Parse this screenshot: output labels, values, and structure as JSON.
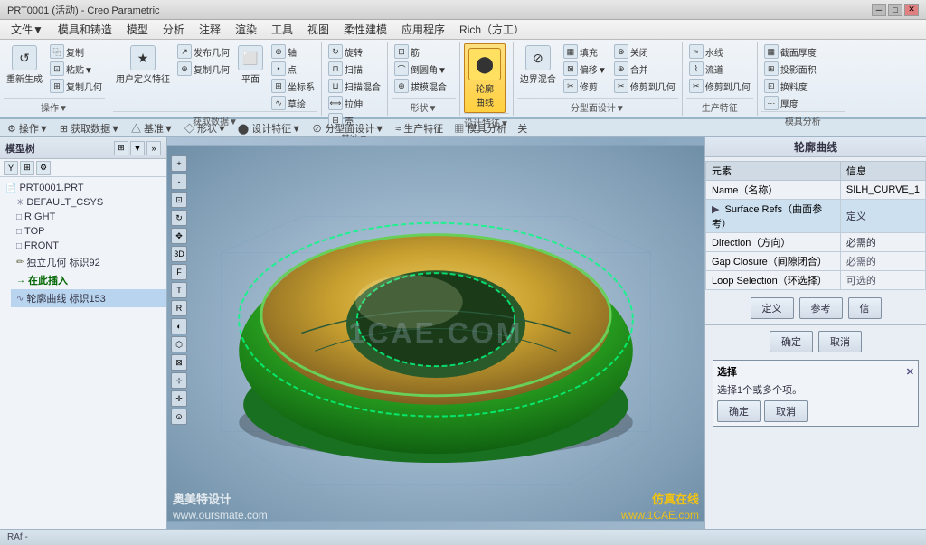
{
  "titlebar": {
    "title": "PRT0001 (活动) - Creo Parametric"
  },
  "menubar": {
    "items": [
      "文件▼",
      "模具和铸造",
      "模型",
      "分析",
      "注释",
      "渲染",
      "工具",
      "视图",
      "柔性建模",
      "应用程序",
      "Rich（方工）"
    ]
  },
  "ribbon": {
    "sections": [
      {
        "label": "操作▼",
        "buttons": [
          {
            "icon": "↺",
            "label": "重新生成"
          },
          {
            "icon": "⿻",
            "label": "复制"
          },
          {
            "icon": "⊡",
            "label": "粘贴▼"
          },
          {
            "icon": "⊞",
            "label": "复制几何"
          }
        ]
      },
      {
        "label": "获取数据▼",
        "buttons": [
          {
            "icon": "★",
            "label": "用户定义特征"
          },
          {
            "icon": "↗",
            "label": "发布几何"
          },
          {
            "icon": "•",
            "label": "复制几何"
          },
          {
            "icon": "⊕",
            "label": "轴"
          },
          {
            "icon": "•",
            "label": "点"
          },
          {
            "icon": "⊞",
            "label": "坐标系"
          },
          {
            "icon": "∿",
            "label": "草绘"
          },
          {
            "icon": "⬜",
            "label": "平面"
          }
        ]
      },
      {
        "label": "基准▼",
        "buttons": [
          {
            "icon": "↻",
            "label": "旋转"
          },
          {
            "icon": "⊓",
            "label": "扫描"
          },
          {
            "icon": "⊔",
            "label": "扫描混合"
          },
          {
            "icon": "⟺",
            "label": "拉伸"
          },
          {
            "icon": "⊟",
            "label": "壳"
          }
        ]
      },
      {
        "label": "形状▼",
        "buttons": [
          {
            "icon": "⊡",
            "label": "筋"
          },
          {
            "icon": "⌒",
            "label": "倒圆角▼"
          },
          {
            "icon": "⊕",
            "label": "拔模混合"
          }
        ]
      },
      {
        "label": "设计特征▼",
        "buttons": [
          {
            "icon": "⬤",
            "label": "轮廓\n曲线",
            "active": true
          }
        ]
      },
      {
        "label": "分型面设计▼",
        "buttons": [
          {
            "icon": "⊘",
            "label": "边界混合"
          },
          {
            "icon": "▦",
            "label": "填充"
          },
          {
            "icon": "⊠",
            "label": "偏移▼"
          },
          {
            "icon": "✂",
            "label": "修剪"
          },
          {
            "icon": "⊗",
            "label": "关闭"
          },
          {
            "icon": "⊕",
            "label": "合并"
          },
          {
            "icon": "✂",
            "label": "修剪到几何"
          }
        ]
      },
      {
        "label": "生产特征",
        "buttons": [
          {
            "icon": "≈",
            "label": "水线"
          },
          {
            "icon": "⌇",
            "label": "流道"
          },
          {
            "icon": "✂",
            "label": "修剪到几何"
          }
        ]
      },
      {
        "label": "模具分析",
        "buttons": [
          {
            "icon": "▦",
            "label": "截面厚度"
          },
          {
            "icon": "⊞",
            "label": "投影面积"
          },
          {
            "icon": "⊡",
            "label": "换料度"
          },
          {
            "icon": "⋯",
            "label": "厚度"
          }
        ]
      }
    ]
  },
  "sidebar": {
    "title": "模型树",
    "items": [
      {
        "id": "root",
        "label": "PRT0001.PRT",
        "icon": "📄",
        "indent": 0
      },
      {
        "id": "csys",
        "label": "DEFAULT_CSYS",
        "icon": "✳",
        "indent": 1
      },
      {
        "id": "right",
        "label": "RIGHT",
        "icon": "□",
        "indent": 1
      },
      {
        "id": "top",
        "label": "TOP",
        "icon": "□",
        "indent": 1
      },
      {
        "id": "front",
        "label": "FRONT",
        "icon": "□",
        "indent": 1
      },
      {
        "id": "sketch",
        "label": "独立几何 标识92",
        "icon": "✏",
        "indent": 1
      },
      {
        "id": "insert",
        "label": "在此插入",
        "icon": "→",
        "indent": 1
      },
      {
        "id": "curve",
        "label": "轮廓曲线 标识153",
        "icon": "∿",
        "indent": 1
      }
    ]
  },
  "canvas": {
    "watermark_left_line1": "奥美特设计",
    "watermark_left_line2": "www.oursmate.com",
    "watermark_right_line1": "仿真在线",
    "watermark_right_line2": "www.1CAE.com",
    "center_label": "1CAE.COM"
  },
  "right_panel": {
    "title": "轮廓曲线",
    "table_header_col1": "元素",
    "table_header_col2": "信息",
    "rows": [
      {
        "name": "Name（名称）",
        "value": "SILH_CURVE_1",
        "active": false
      },
      {
        "name": "Surface Refs（曲面参考）",
        "value": "定义",
        "active": true
      },
      {
        "name": "Direction（方向）",
        "value": "必需的",
        "active": false
      },
      {
        "name": "Gap Closure（间隙闭合）",
        "value": "必需的",
        "active": false
      },
      {
        "name": "Loop Selection（环选择）",
        "value": "可选的",
        "active": false
      }
    ],
    "btn_define": "定义",
    "btn_ref": "参考",
    "btn_confirm": "确定",
    "btn_cancel": "取消",
    "btn_trust": "信",
    "select_panel": {
      "title": "选择",
      "hint": "选择1个或多个项。",
      "btn_ok": "确定",
      "btn_cancel": "取消"
    }
  },
  "status_bar": {
    "text": "RAf -"
  }
}
